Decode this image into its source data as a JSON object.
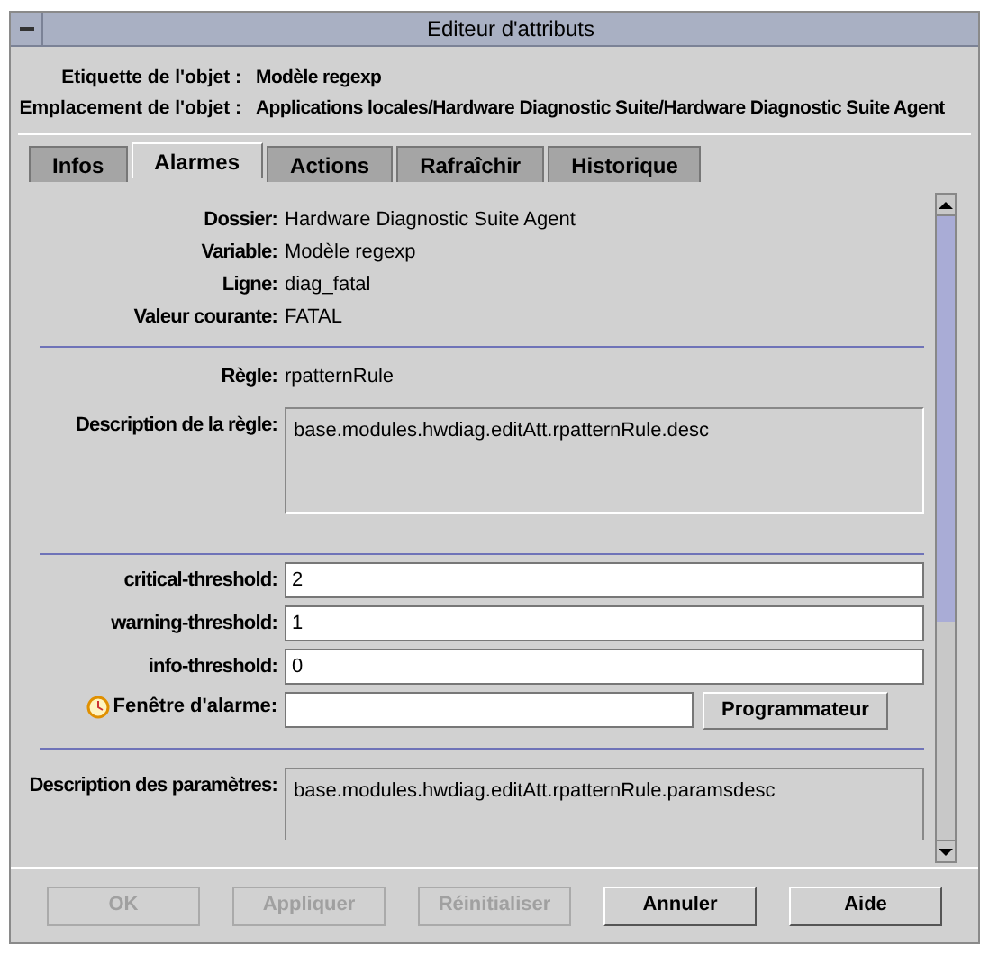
{
  "window": {
    "title": "Editeur d'attributs"
  },
  "header": [
    {
      "label": "Etiquette de l'objet :",
      "value": "Modèle regexp"
    },
    {
      "label": "Emplacement de l'objet :",
      "value": "Applications locales/Hardware Diagnostic Suite/Hardware Diagnostic Suite Agent"
    }
  ],
  "tabs": [
    {
      "label": "Infos",
      "selected": false
    },
    {
      "label": "Alarmes",
      "selected": true
    },
    {
      "label": "Actions",
      "selected": false
    },
    {
      "label": "Rafraîchir",
      "selected": false
    },
    {
      "label": "Historique",
      "selected": false
    }
  ],
  "info_rows": [
    {
      "label": "Dossier:",
      "value": "Hardware Diagnostic Suite Agent"
    },
    {
      "label": "Variable:",
      "value": "Modèle regexp"
    },
    {
      "label": "Ligne:",
      "value": "diag_fatal"
    },
    {
      "label": "Valeur courante:",
      "value": "FATAL"
    }
  ],
  "rule": {
    "label": "Règle:",
    "value": "rpatternRule"
  },
  "rule_description": {
    "label": "Description de la règle:",
    "value": "base.modules.hwdiag.editAtt.rpatternRule.desc"
  },
  "thresholds": [
    {
      "label": "critical-threshold:",
      "value": "2"
    },
    {
      "label": "warning-threshold:",
      "value": "1"
    },
    {
      "label": "info-threshold:",
      "value": "0"
    }
  ],
  "alarm_window": {
    "label": "Fenêtre d'alarme:",
    "button": "Programmateur"
  },
  "params_description": {
    "label": "Description des paramètres:",
    "value": "base.modules.hwdiag.editAtt.rpatternRule.paramsdesc"
  },
  "buttons": [
    {
      "label": "OK",
      "disabled": true
    },
    {
      "label": "Appliquer",
      "disabled": true
    },
    {
      "label": "Réinitialiser",
      "disabled": true
    },
    {
      "label": "Annuler",
      "disabled": false
    },
    {
      "label": "Aide",
      "disabled": false
    }
  ]
}
